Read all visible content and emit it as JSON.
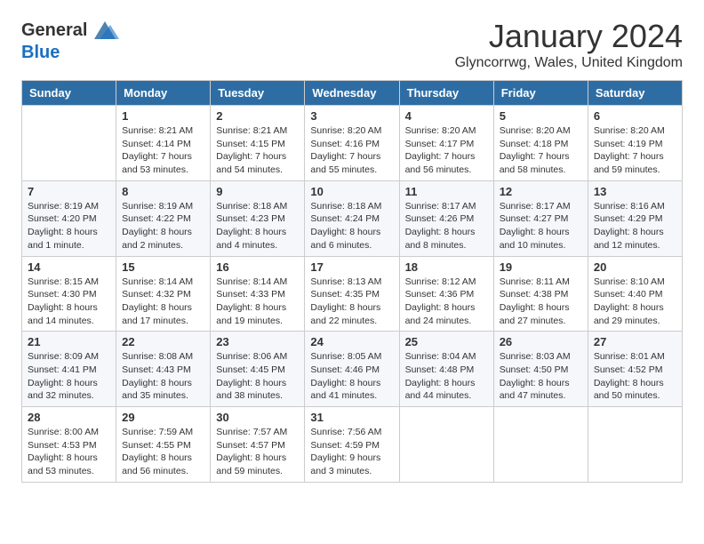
{
  "header": {
    "logo_general": "General",
    "logo_blue": "Blue",
    "month_title": "January 2024",
    "location": "Glyncorrwg, Wales, United Kingdom"
  },
  "days_of_week": [
    "Sunday",
    "Monday",
    "Tuesday",
    "Wednesday",
    "Thursday",
    "Friday",
    "Saturday"
  ],
  "weeks": [
    [
      {
        "day": "",
        "lines": []
      },
      {
        "day": "1",
        "lines": [
          "Sunrise: 8:21 AM",
          "Sunset: 4:14 PM",
          "Daylight: 7 hours",
          "and 53 minutes."
        ]
      },
      {
        "day": "2",
        "lines": [
          "Sunrise: 8:21 AM",
          "Sunset: 4:15 PM",
          "Daylight: 7 hours",
          "and 54 minutes."
        ]
      },
      {
        "day": "3",
        "lines": [
          "Sunrise: 8:20 AM",
          "Sunset: 4:16 PM",
          "Daylight: 7 hours",
          "and 55 minutes."
        ]
      },
      {
        "day": "4",
        "lines": [
          "Sunrise: 8:20 AM",
          "Sunset: 4:17 PM",
          "Daylight: 7 hours",
          "and 56 minutes."
        ]
      },
      {
        "day": "5",
        "lines": [
          "Sunrise: 8:20 AM",
          "Sunset: 4:18 PM",
          "Daylight: 7 hours",
          "and 58 minutes."
        ]
      },
      {
        "day": "6",
        "lines": [
          "Sunrise: 8:20 AM",
          "Sunset: 4:19 PM",
          "Daylight: 7 hours",
          "and 59 minutes."
        ]
      }
    ],
    [
      {
        "day": "7",
        "lines": [
          "Sunrise: 8:19 AM",
          "Sunset: 4:20 PM",
          "Daylight: 8 hours",
          "and 1 minute."
        ]
      },
      {
        "day": "8",
        "lines": [
          "Sunrise: 8:19 AM",
          "Sunset: 4:22 PM",
          "Daylight: 8 hours",
          "and 2 minutes."
        ]
      },
      {
        "day": "9",
        "lines": [
          "Sunrise: 8:18 AM",
          "Sunset: 4:23 PM",
          "Daylight: 8 hours",
          "and 4 minutes."
        ]
      },
      {
        "day": "10",
        "lines": [
          "Sunrise: 8:18 AM",
          "Sunset: 4:24 PM",
          "Daylight: 8 hours",
          "and 6 minutes."
        ]
      },
      {
        "day": "11",
        "lines": [
          "Sunrise: 8:17 AM",
          "Sunset: 4:26 PM",
          "Daylight: 8 hours",
          "and 8 minutes."
        ]
      },
      {
        "day": "12",
        "lines": [
          "Sunrise: 8:17 AM",
          "Sunset: 4:27 PM",
          "Daylight: 8 hours",
          "and 10 minutes."
        ]
      },
      {
        "day": "13",
        "lines": [
          "Sunrise: 8:16 AM",
          "Sunset: 4:29 PM",
          "Daylight: 8 hours",
          "and 12 minutes."
        ]
      }
    ],
    [
      {
        "day": "14",
        "lines": [
          "Sunrise: 8:15 AM",
          "Sunset: 4:30 PM",
          "Daylight: 8 hours",
          "and 14 minutes."
        ]
      },
      {
        "day": "15",
        "lines": [
          "Sunrise: 8:14 AM",
          "Sunset: 4:32 PM",
          "Daylight: 8 hours",
          "and 17 minutes."
        ]
      },
      {
        "day": "16",
        "lines": [
          "Sunrise: 8:14 AM",
          "Sunset: 4:33 PM",
          "Daylight: 8 hours",
          "and 19 minutes."
        ]
      },
      {
        "day": "17",
        "lines": [
          "Sunrise: 8:13 AM",
          "Sunset: 4:35 PM",
          "Daylight: 8 hours",
          "and 22 minutes."
        ]
      },
      {
        "day": "18",
        "lines": [
          "Sunrise: 8:12 AM",
          "Sunset: 4:36 PM",
          "Daylight: 8 hours",
          "and 24 minutes."
        ]
      },
      {
        "day": "19",
        "lines": [
          "Sunrise: 8:11 AM",
          "Sunset: 4:38 PM",
          "Daylight: 8 hours",
          "and 27 minutes."
        ]
      },
      {
        "day": "20",
        "lines": [
          "Sunrise: 8:10 AM",
          "Sunset: 4:40 PM",
          "Daylight: 8 hours",
          "and 29 minutes."
        ]
      }
    ],
    [
      {
        "day": "21",
        "lines": [
          "Sunrise: 8:09 AM",
          "Sunset: 4:41 PM",
          "Daylight: 8 hours",
          "and 32 minutes."
        ]
      },
      {
        "day": "22",
        "lines": [
          "Sunrise: 8:08 AM",
          "Sunset: 4:43 PM",
          "Daylight: 8 hours",
          "and 35 minutes."
        ]
      },
      {
        "day": "23",
        "lines": [
          "Sunrise: 8:06 AM",
          "Sunset: 4:45 PM",
          "Daylight: 8 hours",
          "and 38 minutes."
        ]
      },
      {
        "day": "24",
        "lines": [
          "Sunrise: 8:05 AM",
          "Sunset: 4:46 PM",
          "Daylight: 8 hours",
          "and 41 minutes."
        ]
      },
      {
        "day": "25",
        "lines": [
          "Sunrise: 8:04 AM",
          "Sunset: 4:48 PM",
          "Daylight: 8 hours",
          "and 44 minutes."
        ]
      },
      {
        "day": "26",
        "lines": [
          "Sunrise: 8:03 AM",
          "Sunset: 4:50 PM",
          "Daylight: 8 hours",
          "and 47 minutes."
        ]
      },
      {
        "day": "27",
        "lines": [
          "Sunrise: 8:01 AM",
          "Sunset: 4:52 PM",
          "Daylight: 8 hours",
          "and 50 minutes."
        ]
      }
    ],
    [
      {
        "day": "28",
        "lines": [
          "Sunrise: 8:00 AM",
          "Sunset: 4:53 PM",
          "Daylight: 8 hours",
          "and 53 minutes."
        ]
      },
      {
        "day": "29",
        "lines": [
          "Sunrise: 7:59 AM",
          "Sunset: 4:55 PM",
          "Daylight: 8 hours",
          "and 56 minutes."
        ]
      },
      {
        "day": "30",
        "lines": [
          "Sunrise: 7:57 AM",
          "Sunset: 4:57 PM",
          "Daylight: 8 hours",
          "and 59 minutes."
        ]
      },
      {
        "day": "31",
        "lines": [
          "Sunrise: 7:56 AM",
          "Sunset: 4:59 PM",
          "Daylight: 9 hours",
          "and 3 minutes."
        ]
      },
      {
        "day": "",
        "lines": []
      },
      {
        "day": "",
        "lines": []
      },
      {
        "day": "",
        "lines": []
      }
    ]
  ]
}
